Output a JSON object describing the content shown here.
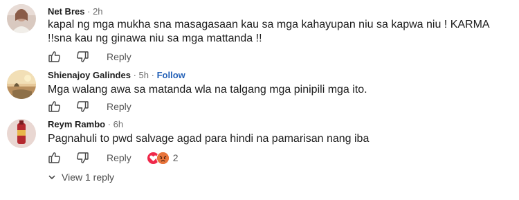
{
  "comments": [
    {
      "author": "Net Bres",
      "time": "2h",
      "text": "kapal ng mga mukha sna masagasaan kau sa mga kahayupan niu sa kapwa niu ! KARMA !!sna kau ng ginawa niu sa mga mattanda !!",
      "reply_label": "Reply",
      "like_icon": "thumbs-up-icon",
      "dislike_icon": "thumbs-down-icon"
    },
    {
      "author": "Shienajoy Galindes",
      "time": "5h",
      "follow_label": "Follow",
      "text": "Mga walang awa sa matanda wla na talgang mga pinipili mga ito.",
      "reply_label": "Reply",
      "like_icon": "thumbs-up-icon",
      "dislike_icon": "thumbs-down-icon"
    },
    {
      "author": "Reym Rambo",
      "time": "6h",
      "text": "Pagnahuli to pwd salvage agad para hindi na pamarisan nang iba",
      "reply_label": "Reply",
      "like_icon": "thumbs-up-icon",
      "dislike_icon": "thumbs-down-icon",
      "reactions": {
        "icons": [
          "heart-reaction-icon",
          "angry-reaction-icon"
        ],
        "count": "2"
      }
    }
  ],
  "view_replies_label": "View 1 reply",
  "separator": "·",
  "colors": {
    "follow": "#2562b8",
    "muted": "#6b6b6b",
    "text": "#1c1c1c",
    "heart": "#f0284a",
    "angry": "#e8743b"
  }
}
